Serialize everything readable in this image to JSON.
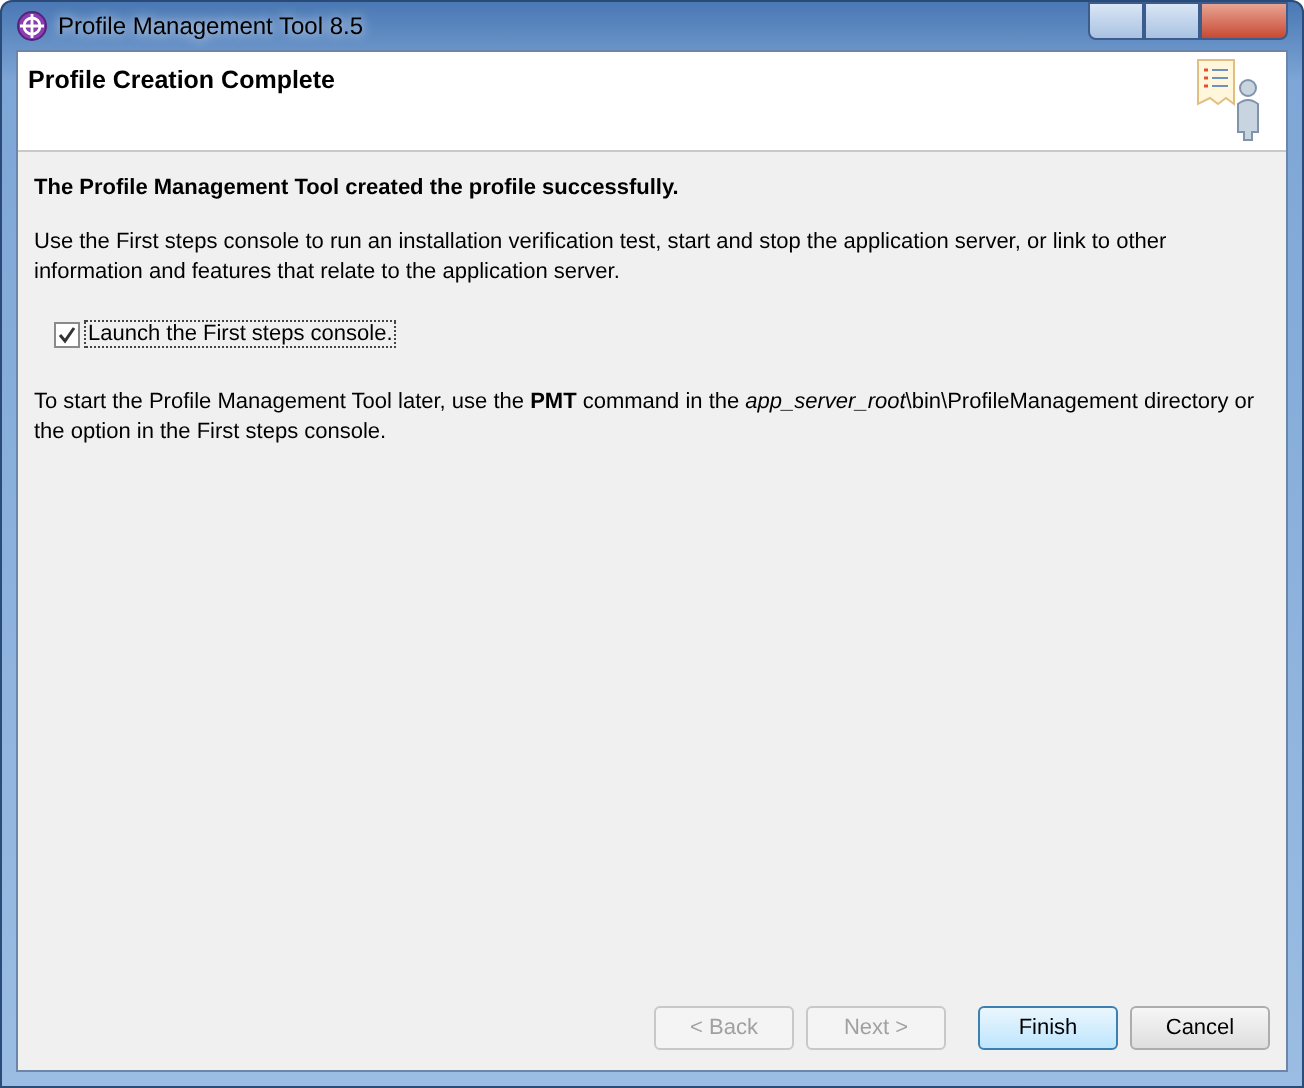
{
  "window": {
    "title": "Profile Management Tool 8.5"
  },
  "header": {
    "title": "Profile Creation Complete"
  },
  "content": {
    "heading": "The Profile Management Tool created the profile successfully.",
    "description": "Use the First steps console to run an installation verification test, start and stop the application server, or link to other information and features that relate to the application server.",
    "checkbox": {
      "label": "Launch the First steps console.",
      "checked": true
    },
    "note": "To start the Profile Management Tool later, use the **PMT** command in the *app_server_root*\\bin\\ProfileManagement directory or the option in the First steps console."
  },
  "buttons": [
    {
      "label": "< Back",
      "disabled": true,
      "default": false
    },
    {
      "label": "Next >",
      "disabled": true,
      "default": false
    },
    {
      "label": "Finish",
      "disabled": false,
      "default": true
    },
    {
      "label": "Cancel",
      "disabled": false,
      "default": false
    }
  ]
}
